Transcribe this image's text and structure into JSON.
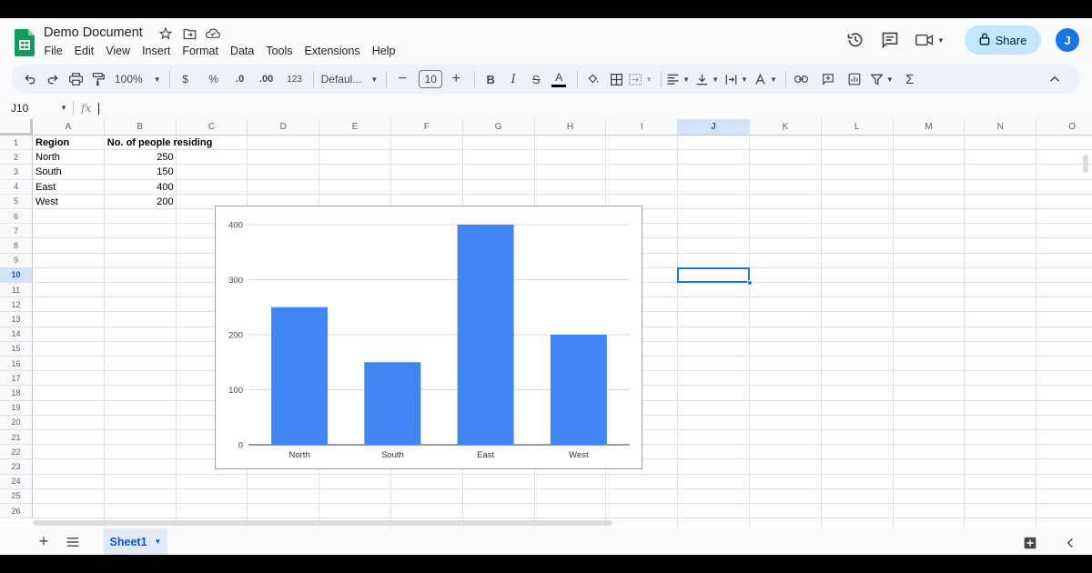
{
  "document": {
    "title": "Demo Document"
  },
  "menu": [
    "File",
    "Edit",
    "View",
    "Insert",
    "Format",
    "Data",
    "Tools",
    "Extensions",
    "Help"
  ],
  "header": {
    "share_label": "Share",
    "avatar_initial": "J"
  },
  "toolbar": {
    "zoom": "100%",
    "currency": "$",
    "percent": "%",
    "decrease_decimal": ".0",
    "increase_decimal": ".00",
    "number_format": "123",
    "font": "Defaul...",
    "font_size": "10"
  },
  "formula_bar": {
    "name_box": "J10",
    "fx": "fx",
    "value": ""
  },
  "grid": {
    "columns": [
      "A",
      "B",
      "C",
      "D",
      "E",
      "F",
      "G",
      "H",
      "I",
      "J",
      "K",
      "L",
      "M",
      "N",
      "O"
    ],
    "selected_column": "J",
    "rows": [
      "1",
      "2",
      "3",
      "4",
      "5",
      "6",
      "7",
      "8",
      "9",
      "10",
      "11",
      "12",
      "13",
      "14",
      "15",
      "16",
      "17",
      "18",
      "19",
      "20",
      "21",
      "22",
      "23",
      "24",
      "25",
      "26"
    ],
    "selected_row": "10",
    "selected_cell": "J10",
    "data": [
      {
        "a": "Region",
        "b": "No. of people residing"
      },
      {
        "a": "North",
        "b": "250"
      },
      {
        "a": "South",
        "b": "150"
      },
      {
        "a": "East",
        "b": "400"
      },
      {
        "a": "West",
        "b": "200"
      }
    ]
  },
  "chart_data": {
    "type": "bar",
    "categories": [
      "North",
      "South",
      "East",
      "West"
    ],
    "values": [
      250,
      150,
      400,
      200
    ],
    "title": "",
    "xlabel": "",
    "ylabel": "",
    "ylim": [
      0,
      400
    ],
    "yticks": [
      "0",
      "100",
      "200",
      "300",
      "400"
    ],
    "grid": true,
    "bar_color": "#4285f4"
  },
  "sheets": [
    {
      "name": "Sheet1",
      "active": true
    }
  ],
  "colors": {
    "accent": "#1a73e8",
    "share_bg": "#c2e7ff",
    "sheets_green": "#0f9d58"
  }
}
